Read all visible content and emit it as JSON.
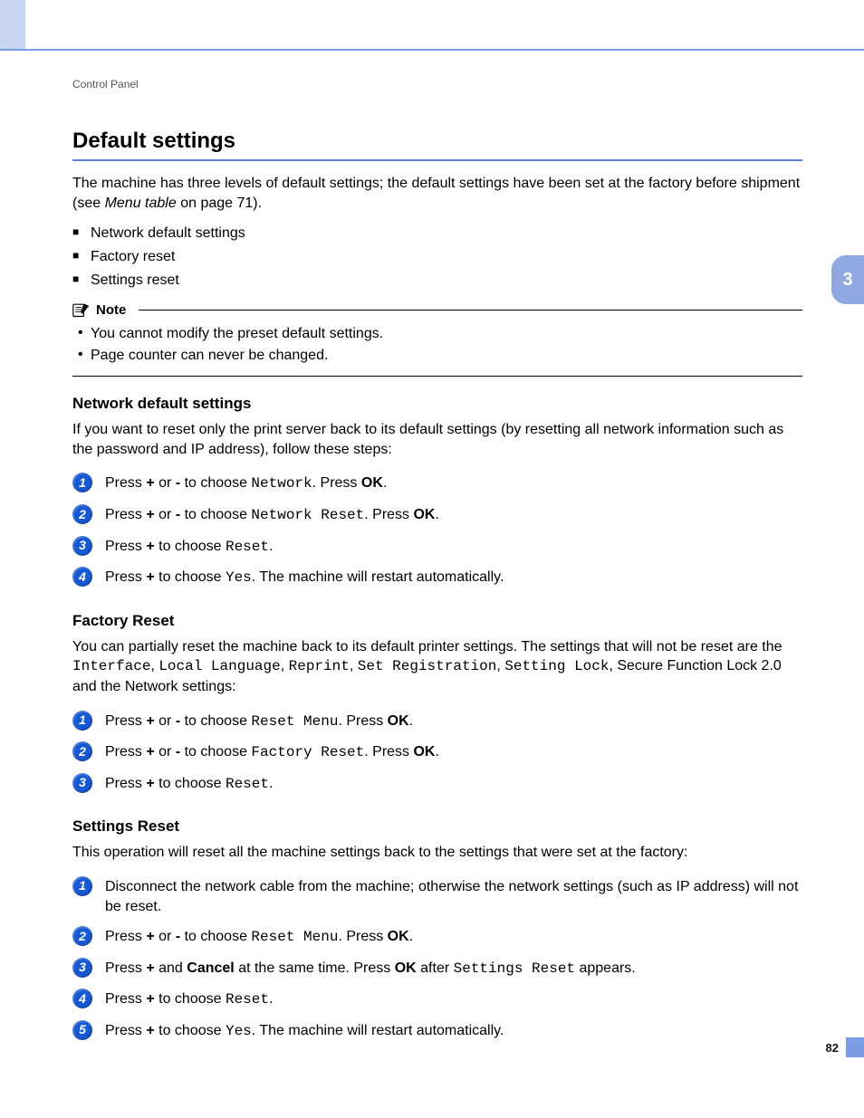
{
  "header": {
    "breadcrumb": "Control Panel"
  },
  "sideTab": "3",
  "pageNumber": "82",
  "title": "Default settings",
  "intro": {
    "pre": "The machine has three levels of default settings; the default settings have been set at the factory before shipment (see ",
    "linkText": "Menu table",
    "post": " on page 71)."
  },
  "bullets": [
    "Network default settings",
    "Factory reset",
    "Settings reset"
  ],
  "note": {
    "label": "Note",
    "items": [
      "You cannot modify the preset default settings.",
      "Page counter can never be changed."
    ]
  },
  "sections": {
    "network": {
      "heading": "Network default settings",
      "intro": "If you want to reset only the print server back to its default settings (by resetting all network information such as the password and IP address), follow these steps:",
      "steps": [
        {
          "segments": [
            {
              "t": "Press "
            },
            {
              "t": "+",
              "b": true
            },
            {
              "t": " or "
            },
            {
              "t": "-",
              "b": true
            },
            {
              "t": " to choose "
            },
            {
              "t": "Network",
              "m": true
            },
            {
              "t": ". Press "
            },
            {
              "t": "OK",
              "b": true
            },
            {
              "t": "."
            }
          ]
        },
        {
          "segments": [
            {
              "t": "Press "
            },
            {
              "t": "+",
              "b": true
            },
            {
              "t": " or "
            },
            {
              "t": "-",
              "b": true
            },
            {
              "t": " to choose "
            },
            {
              "t": "Network Reset",
              "m": true
            },
            {
              "t": ". Press "
            },
            {
              "t": "OK",
              "b": true
            },
            {
              "t": "."
            }
          ]
        },
        {
          "segments": [
            {
              "t": "Press "
            },
            {
              "t": "+",
              "b": true
            },
            {
              "t": " to choose "
            },
            {
              "t": "Reset",
              "m": true
            },
            {
              "t": "."
            }
          ]
        },
        {
          "segments": [
            {
              "t": "Press "
            },
            {
              "t": "+",
              "b": true
            },
            {
              "t": " to choose "
            },
            {
              "t": "Yes",
              "m": true
            },
            {
              "t": ". The machine will restart automatically."
            }
          ]
        }
      ]
    },
    "factory": {
      "heading": "Factory Reset",
      "intro": {
        "segments": [
          {
            "t": "You can partially reset the machine back to its default printer settings. The settings that will not be reset are the "
          },
          {
            "t": "Interface",
            "m": true
          },
          {
            "t": ", "
          },
          {
            "t": "Local Language",
            "m": true
          },
          {
            "t": ", "
          },
          {
            "t": "Reprint",
            "m": true
          },
          {
            "t": ", "
          },
          {
            "t": "Set Registration",
            "m": true
          },
          {
            "t": ", "
          },
          {
            "t": "Setting Lock",
            "m": true
          },
          {
            "t": ", Secure Function Lock 2.0 and the Network settings:"
          }
        ]
      },
      "steps": [
        {
          "segments": [
            {
              "t": "Press "
            },
            {
              "t": "+",
              "b": true
            },
            {
              "t": " or "
            },
            {
              "t": "-",
              "b": true
            },
            {
              "t": " to choose "
            },
            {
              "t": "Reset Menu",
              "m": true
            },
            {
              "t": ". Press "
            },
            {
              "t": "OK",
              "b": true
            },
            {
              "t": "."
            }
          ]
        },
        {
          "segments": [
            {
              "t": "Press "
            },
            {
              "t": "+",
              "b": true
            },
            {
              "t": " or "
            },
            {
              "t": "-",
              "b": true
            },
            {
              "t": " to choose "
            },
            {
              "t": "Factory Reset",
              "m": true
            },
            {
              "t": ". Press "
            },
            {
              "t": "OK",
              "b": true
            },
            {
              "t": "."
            }
          ]
        },
        {
          "segments": [
            {
              "t": "Press "
            },
            {
              "t": "+",
              "b": true
            },
            {
              "t": " to choose "
            },
            {
              "t": "Reset",
              "m": true
            },
            {
              "t": "."
            }
          ]
        }
      ]
    },
    "settings": {
      "heading": "Settings Reset",
      "intro": "This operation will reset all the machine settings back to the settings that were set at the factory:",
      "steps": [
        {
          "segments": [
            {
              "t": "Disconnect the network cable from the machine; otherwise the network settings (such as IP address) will not be reset."
            }
          ]
        },
        {
          "segments": [
            {
              "t": "Press "
            },
            {
              "t": "+",
              "b": true
            },
            {
              "t": " or "
            },
            {
              "t": "-",
              "b": true
            },
            {
              "t": " to choose "
            },
            {
              "t": "Reset Menu",
              "m": true
            },
            {
              "t": ". Press "
            },
            {
              "t": "OK",
              "b": true
            },
            {
              "t": "."
            }
          ]
        },
        {
          "segments": [
            {
              "t": "Press "
            },
            {
              "t": "+",
              "b": true
            },
            {
              "t": " and "
            },
            {
              "t": "Cancel",
              "b": true
            },
            {
              "t": " at the same time. Press "
            },
            {
              "t": "OK",
              "b": true
            },
            {
              "t": " after "
            },
            {
              "t": "Settings Reset",
              "m": true
            },
            {
              "t": " appears."
            }
          ]
        },
        {
          "segments": [
            {
              "t": "Press "
            },
            {
              "t": "+",
              "b": true
            },
            {
              "t": " to choose "
            },
            {
              "t": "Reset",
              "m": true
            },
            {
              "t": "."
            }
          ]
        },
        {
          "segments": [
            {
              "t": "Press "
            },
            {
              "t": "+",
              "b": true
            },
            {
              "t": " to choose "
            },
            {
              "t": "Yes",
              "m": true
            },
            {
              "t": ". The machine will restart automatically."
            }
          ]
        }
      ]
    }
  }
}
